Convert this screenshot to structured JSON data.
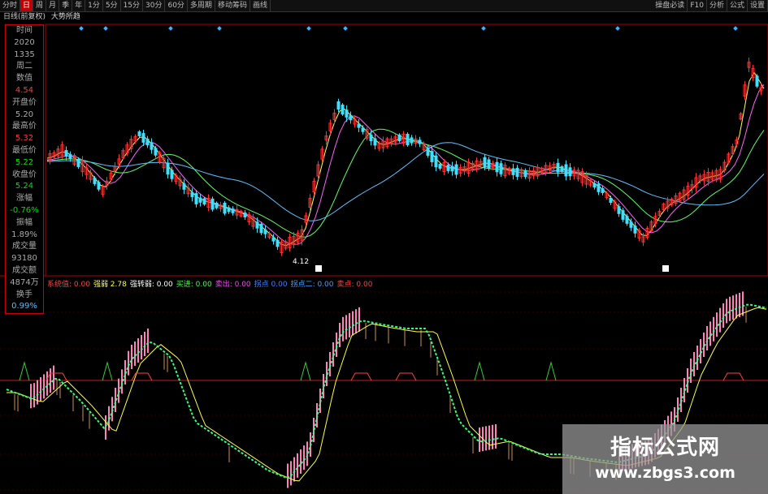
{
  "toolbar": {
    "items": [
      "分时",
      "日",
      "周",
      "月",
      "季",
      "年",
      "1分",
      "5分",
      "15分",
      "30分",
      "60分",
      "多周期",
      "移动筹码",
      "画线"
    ],
    "active_index": 1,
    "right_items": [
      "操盘必读",
      "F10",
      "分析",
      "公式",
      "设置"
    ]
  },
  "infobar": {
    "title": "日线(前复权)",
    "formula": "大势所趋"
  },
  "sidepanel": {
    "rows": [
      {
        "text": "时间",
        "color": "#aaaaaa"
      },
      {
        "text": "2020",
        "color": "#aaaaaa"
      },
      {
        "text": "1335",
        "color": "#aaaaaa"
      },
      {
        "text": "周二",
        "color": "#aaaaaa"
      },
      {
        "text": "数值",
        "color": "#aaaaaa"
      },
      {
        "text": "4.54",
        "color": "#ff3b3b"
      },
      {
        "text": "开盘价",
        "color": "#aaaaaa"
      },
      {
        "text": "5.20",
        "color": "#aaaaaa"
      },
      {
        "text": "最高价",
        "color": "#aaaaaa"
      },
      {
        "text": "5.32",
        "color": "#ff3b3b"
      },
      {
        "text": "最低价",
        "color": "#aaaaaa"
      },
      {
        "text": "5.22",
        "color": "#00e000"
      },
      {
        "text": "收盘价",
        "color": "#aaaaaa"
      },
      {
        "text": "5.24",
        "color": "#00e000"
      },
      {
        "text": "涨幅",
        "color": "#aaaaaa"
      },
      {
        "text": "-0.76%",
        "color": "#00e000"
      },
      {
        "text": "振幅",
        "color": "#aaaaaa"
      },
      {
        "text": "1.89%",
        "color": "#aaaaaa"
      },
      {
        "text": "成交量",
        "color": "#aaaaaa"
      },
      {
        "text": "93180",
        "color": "#aaaaaa"
      },
      {
        "text": "成交额",
        "color": "#aaaaaa"
      },
      {
        "text": "4874万",
        "color": "#aaaaaa"
      },
      {
        "text": "换手",
        "color": "#aaaaaa"
      },
      {
        "text": "0.99%",
        "color": "#4fc3ff"
      }
    ]
  },
  "price_annotation": "4.12",
  "legend": [
    {
      "label": "系统值:",
      "value": "0.00",
      "color": "#ff4040"
    },
    {
      "label": "强弱",
      "value": "2.78",
      "color": "#ffff40"
    },
    {
      "label": "强转弱:",
      "value": "0.00",
      "color": "#ffffff"
    },
    {
      "label": "买进:",
      "value": "0.00",
      "color": "#40ff40"
    },
    {
      "label": "卖出:",
      "value": "0.00",
      "color": "#ff40ff"
    },
    {
      "label": "拐点",
      "value": "0.00",
      "color": "#4080ff"
    },
    {
      "label": "拐点二:",
      "value": "0.00",
      "color": "#40a0ff"
    },
    {
      "label": "卖点:",
      "value": "0.00",
      "color": "#ff4040"
    }
  ],
  "watermark": {
    "line1": "指标公式网",
    "line2": "www.zbgs3.com"
  },
  "colors": {
    "up": "#ff3030",
    "down": "#3fe0ff",
    "grid": "#b00000"
  }
}
